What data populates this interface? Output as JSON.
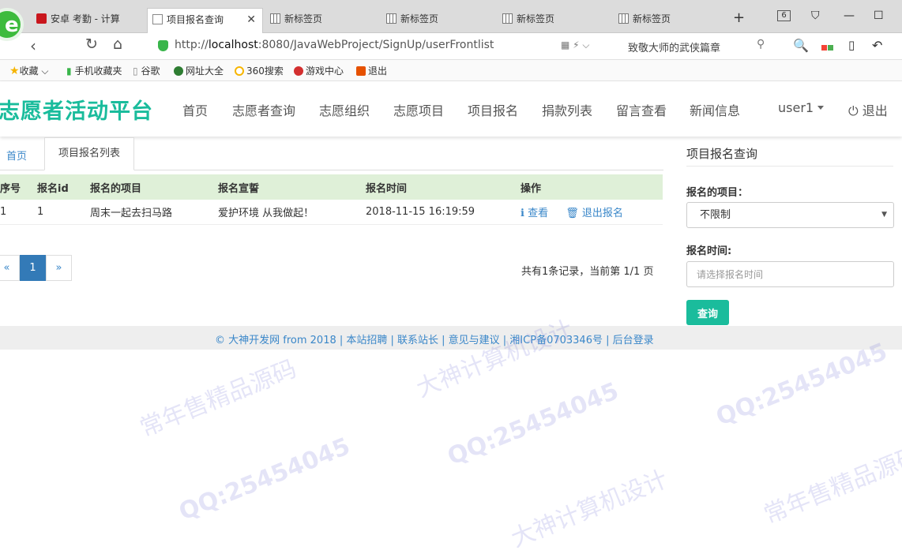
{
  "browser": {
    "tabs": [
      {
        "label": "安卓 考勤 - 计算"
      },
      {
        "label": "项目报名查询"
      },
      {
        "label": "新标签页"
      },
      {
        "label": "新标签页"
      },
      {
        "label": "新标签页"
      },
      {
        "label": "新标签页"
      }
    ],
    "tab_count": "6",
    "new_tab_symbol": "+",
    "url_scheme": "http://",
    "url_host": "localhost",
    "url_path": ":8080/JavaWebProject/SignUp/userFrontlist",
    "suggestion": "致敬大师的武侠篇章",
    "bookmarks": [
      {
        "label": "收藏",
        "color": "#f5b400"
      },
      {
        "label": "手机收藏夹",
        "color": "#39b54a"
      },
      {
        "label": "谷歌",
        "color": "#888888"
      },
      {
        "label": "网址大全",
        "color": "#2e7d32"
      },
      {
        "label": "360搜索",
        "color": "#f7b500"
      },
      {
        "label": "游戏中心",
        "color": "#d32f2f"
      },
      {
        "label": "退出",
        "color": "#e65100"
      }
    ]
  },
  "site": {
    "logo": "志愿者活动平台",
    "nav": [
      "首页",
      "志愿者查询",
      "志愿组织",
      "志愿项目",
      "项目报名",
      "捐款列表",
      "留言查看",
      "新闻信息"
    ],
    "user": "user1",
    "logout": "退出",
    "accent_color": "#1abc9c"
  },
  "breadcrumb": {
    "home": "首页",
    "current_tab": "项目报名列表"
  },
  "table": {
    "columns": [
      "序号",
      "报名id",
      "报名的项目",
      "报名宣誓",
      "报名时间",
      "操作"
    ],
    "rows": [
      {
        "index": "1",
        "id": "1",
        "project": "周末一起去扫马路",
        "oath": "爱护环境 从我做起！",
        "time": "2018-11-15 16:19:59",
        "view": "查看",
        "withdraw": "退出报名"
      }
    ]
  },
  "pagination": {
    "prev": "«",
    "current": "1",
    "next": "»",
    "info": "共有1条记录，当前第 1/1 页"
  },
  "sidebar": {
    "title": "项目报名查询",
    "project_label": "报名的项目：",
    "project_value": "不限制",
    "time_label": "报名时间:",
    "time_placeholder": "请选择报名时间",
    "query_button": "查询"
  },
  "footer": {
    "text": "© 大神开发网 from 2018 | 本站招聘 | 联系站长 | 意见与建议 | 湘ICP备0703346号 | 后台登录"
  },
  "watermarks": [
    "QQ:25454045",
    "常年售精品源码",
    "大神计算机设计"
  ]
}
